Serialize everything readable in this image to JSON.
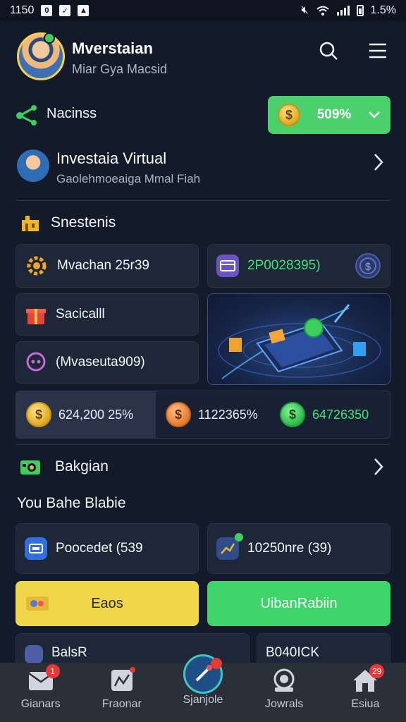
{
  "status_bar": {
    "time": "1150",
    "battery": "1.5%"
  },
  "profile": {
    "name": "Mverstaian",
    "subtitle": "Miar Gya Macsid"
  },
  "nav_row": {
    "label": "Nacinss",
    "balance": "509%"
  },
  "invest": {
    "title": "Investaia Virtual",
    "subtitle": "Gaolehmoeaiga Mmal Fiah"
  },
  "section1": {
    "title": "Snestenis"
  },
  "cards": {
    "card1": "Mvachan 25r39",
    "card2": "2P0028395)",
    "card3": "Sacicalll",
    "card4": "(Mvaseuta909)"
  },
  "stats": [
    {
      "value": "624,200 25%",
      "coin": "gold"
    },
    {
      "value": "1122365%",
      "coin": "orange"
    },
    {
      "value": "64726350",
      "coin": "green"
    }
  ],
  "section2": {
    "title": "Bakgian",
    "subtitle": "You Bahe Blabie"
  },
  "cards2": {
    "left": "Poocedet (539",
    "right": "10250nre (39)"
  },
  "buttons": {
    "yellow": "Eaos",
    "green": "UibanRabiin"
  },
  "partial_cards": {
    "left": "BalsR",
    "right": "B040ICK"
  },
  "bottom_nav": [
    {
      "label": "Gianars",
      "badge": "1"
    },
    {
      "label": "Fraonar",
      "badge": ""
    },
    {
      "label": "Sjanjole",
      "badge": ""
    },
    {
      "label": "Jowrals",
      "badge": ""
    },
    {
      "label": "Esiua",
      "badge": "29"
    }
  ],
  "colors": {
    "accent_green": "#4cd06c",
    "accent_yellow": "#f0d74a",
    "background": "#131b2b",
    "card": "#1e2738"
  }
}
